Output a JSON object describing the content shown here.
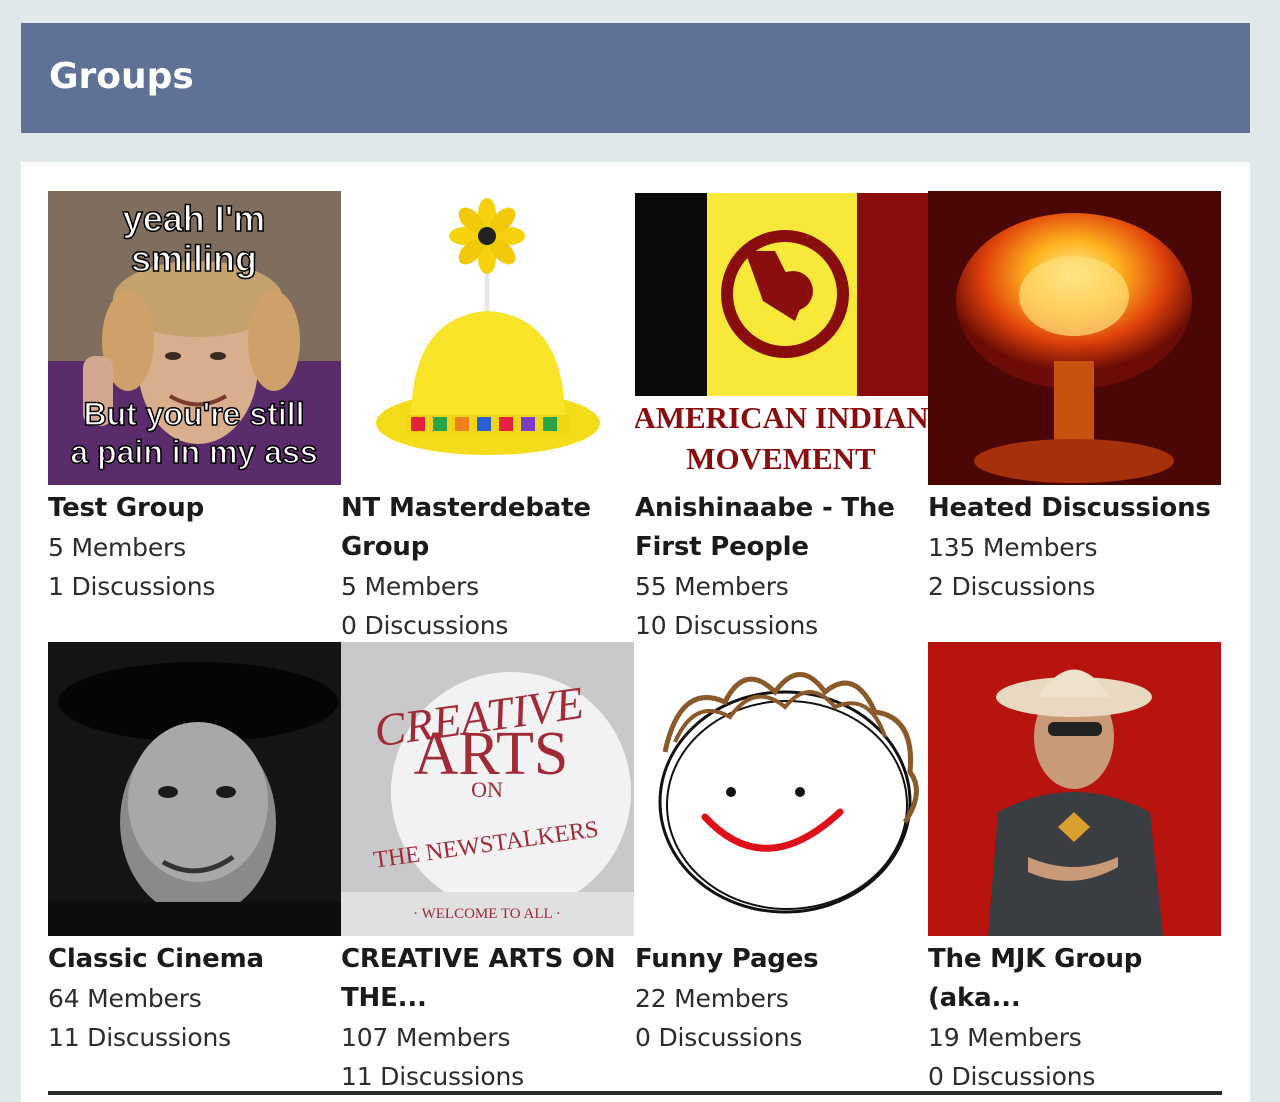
{
  "header": {
    "title": "Groups"
  },
  "groups": [
    {
      "name": "Test Group",
      "members": "5 Members",
      "discussions": "1 Discussions",
      "image": {
        "top": "yeah I'm",
        "top2": "smiling",
        "bottom": "But you're still",
        "bottom2": "a pain in my ass"
      }
    },
    {
      "name": "NT Masterdebate Group",
      "members": "5 Members",
      "discussions": "0 Discussions",
      "image": {}
    },
    {
      "name": "Anishinaabe - The First People",
      "members": "55 Members",
      "discussions": "10 Discussions",
      "image": {
        "line1": "AMERICAN INDIAN",
        "line2": "MOVEMENT"
      }
    },
    {
      "name": "Heated Discussions",
      "members": "135 Members",
      "discussions": "2 Discussions",
      "image": {}
    },
    {
      "name": "Classic Cinema",
      "members": "64 Members",
      "discussions": "11 Discussions",
      "image": {}
    },
    {
      "name": "CREATIVE ARTS ON THE...",
      "members": "107 Members",
      "discussions": "11 Discussions",
      "image": {
        "word1": "CREATIVE",
        "word2": "ARTS",
        "word3": "ON",
        "word4": "THE NEWSTALKERS",
        "word5": "· WELCOME TO ALL ·"
      }
    },
    {
      "name": "Funny Pages",
      "members": "22 Members",
      "discussions": "0 Discussions",
      "image": {}
    },
    {
      "name": "The MJK Group (aka...",
      "members": "19 Members",
      "discussions": "0 Discussions",
      "image": {}
    }
  ]
}
